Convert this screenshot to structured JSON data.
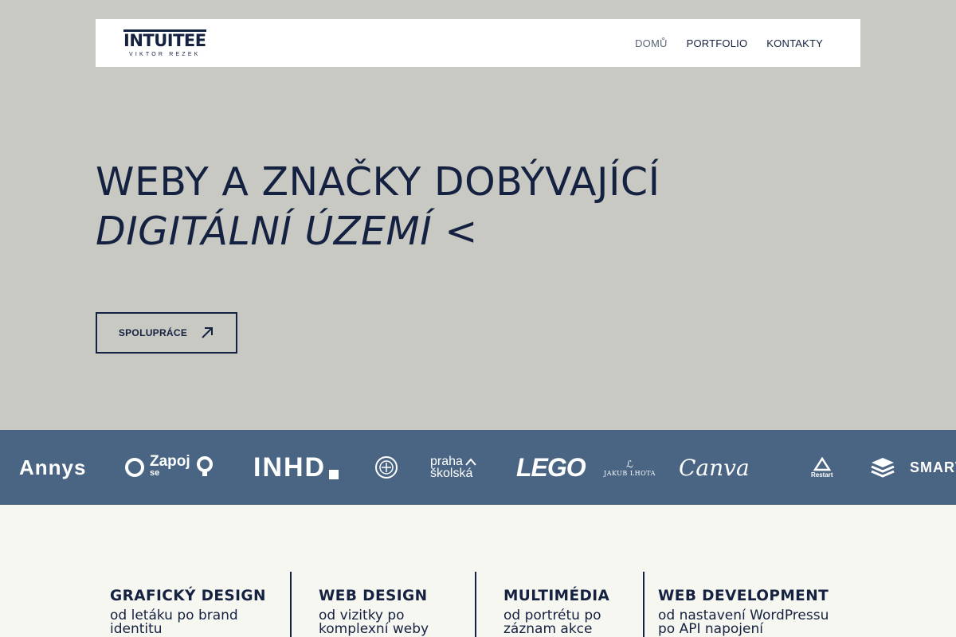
{
  "brand": {
    "name": "INTUITEE",
    "tagline": "VIKTOR REZEK"
  },
  "nav": {
    "items": [
      {
        "label": "DOMŮ",
        "active": true
      },
      {
        "label": "PORTFOLIO",
        "active": false
      },
      {
        "label": "KONTAKTY",
        "active": false
      }
    ]
  },
  "hero": {
    "line1": "WEBY A ZNAČKY DOBÝVAJÍCÍ",
    "line2": "DIGITÁLNÍ ÚZEMÍ <",
    "cta_label": "SPOLUPRÁCE",
    "cta_icon": "arrow-up-right-icon"
  },
  "clients": {
    "annys": "Annys",
    "zapoj_top": "Zapoj",
    "zapoj_bottom": "se",
    "inhd": "INHD",
    "praha_top": "praha",
    "praha_bottom": "školská",
    "lego": "LEGO",
    "lhota": "JAKUB LHOTA",
    "canva": "Canva",
    "restart": "Restart",
    "smart": "SMART"
  },
  "services": [
    {
      "title": "GRAFICKÝ DESIGN",
      "line1": "od letáku po brand",
      "line2": "identitu"
    },
    {
      "title": "WEB DESIGN",
      "line1": "od vizitky po",
      "line2": "komplexní weby"
    },
    {
      "title": "MULTIMÉDIA",
      "line1": "od portrétu po",
      "line2": "záznam akce"
    },
    {
      "title": "WEB DEVELOPMENT",
      "line1": "od nastavení WordPressu",
      "line2": "po API napojení"
    }
  ],
  "colors": {
    "navy": "#152140",
    "hero_bg": "#c9c9c4",
    "strip_bg": "#4a6583",
    "services_bg": "#f7f7f2"
  }
}
